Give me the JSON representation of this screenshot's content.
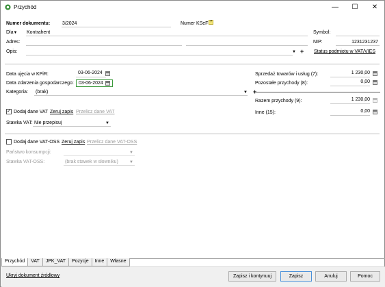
{
  "window": {
    "title": "Przychód",
    "icon": "app-icon",
    "controls": {
      "minimize": "—",
      "maximize": "☐",
      "close": "✕"
    }
  },
  "header": {
    "doc_number_label": "Numer dokumentu:",
    "doc_number_value": "3/2024",
    "ksef_label": "Numer KSeF:",
    "ksef_icon": "?",
    "dla_label": "Dla",
    "contractor_value": "Kontrahent",
    "symbol_label": "Symbol:",
    "symbol_value": "",
    "address_label": "Adres:",
    "address_value": "",
    "nip_label": "NIP:",
    "nip_value": "1231231237",
    "opis_label": "Opis:",
    "opis_value": "",
    "opis_add": "+",
    "vat_status_link": "Status podmiotu w VAT/VIES"
  },
  "dates": {
    "kpir_label": "Data ujęcia w KPiR:",
    "kpir_value": "03-06-2024",
    "event_label": "Data zdarzenia gospodarczego:",
    "event_value": "03-06-2024",
    "category_label": "Kategoria:",
    "category_value": "(brak)",
    "category_add": "+"
  },
  "amounts": {
    "sales_label": "Sprzedaż towarów i usług (7):",
    "sales_value": "1 230,00",
    "other_label": "Pozostałe przychody (8):",
    "other_value": "0,00",
    "total_label": "Razem przychody (9):",
    "total_value": "1 230,00",
    "misc_label": "Inne (15):",
    "misc_value": "0,00"
  },
  "vat": {
    "add_vat_checked": true,
    "add_vat_label": "Dodaj dane VAT",
    "reset_link": "Zeruj zapis",
    "recalc_link": "Przelicz dane VAT",
    "rate_label": "Stawka VAT:",
    "rate_value": "Nie przepisuj"
  },
  "vat_oss": {
    "add_oss_checked": false,
    "add_oss_label": "Dodaj dane VAT-OSS",
    "reset_link": "Zeruj zapis",
    "recalc_link": "Przelicz dane VAT-OSS",
    "country_label": "Państwo konsumpcji:",
    "country_value": "",
    "rate_label": "Stawka VAT-OSS:",
    "rate_value": "(brak stawek w słowniku)"
  },
  "tabs": [
    "Przychód",
    "VAT",
    "JPK_VAT",
    "Pozycje",
    "Inne",
    "Własne"
  ],
  "footer": {
    "hide_source_link": "Ukryj dokument źródłowy",
    "save_continue": "Zapisz i kontynuuj",
    "save": "Zapisz",
    "cancel": "Anuluj",
    "help": "Pomoc"
  }
}
